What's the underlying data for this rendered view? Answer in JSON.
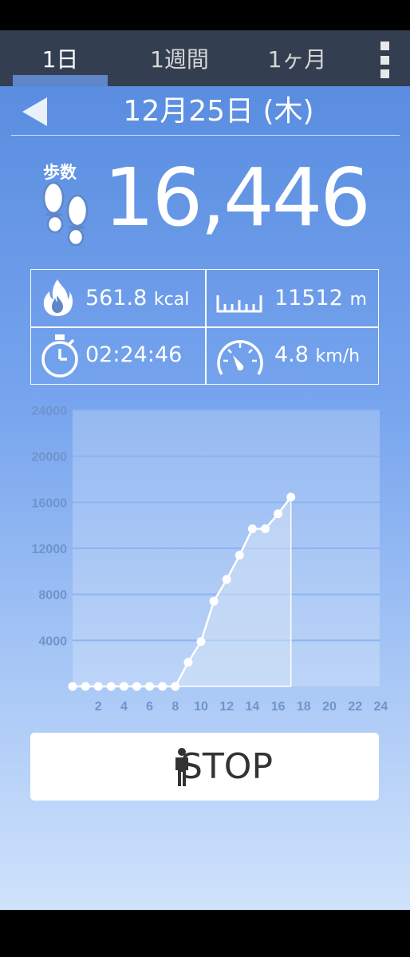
{
  "tabs": [
    {
      "label": "1日"
    },
    {
      "label": "1週間"
    },
    {
      "label": "1ヶ月"
    }
  ],
  "date": "12月25日 (木)",
  "steps": {
    "label": "歩数",
    "value": "16,446"
  },
  "stats": {
    "calories": {
      "value": "561.8",
      "unit": "kcal"
    },
    "distance": {
      "value": "11512",
      "unit": "m"
    },
    "time": {
      "value": "02:24:46"
    },
    "speed": {
      "value": "4.8",
      "unit": "km/h"
    }
  },
  "colors": {
    "header": "#333f50",
    "accent": "#5e86c8",
    "fire_icon": "#ffffff"
  },
  "chart_data": {
    "type": "area",
    "x": [
      0,
      1,
      2,
      3,
      4,
      5,
      6,
      7,
      8,
      9,
      10,
      11,
      12,
      13,
      14,
      15,
      16,
      17
    ],
    "values": [
      0,
      0,
      0,
      0,
      0,
      0,
      0,
      0,
      0,
      2100,
      3900,
      7400,
      9300,
      11400,
      13700,
      13700,
      15000,
      16446
    ],
    "xticks": [
      "2",
      "4",
      "6",
      "8",
      "10",
      "12",
      "14",
      "16",
      "18",
      "20",
      "22",
      "24"
    ],
    "yticks": [
      "4000",
      "8000",
      "12000",
      "16000",
      "20000",
      "24000"
    ],
    "xlim": [
      0,
      24
    ],
    "ylim": [
      0,
      24000
    ],
    "grid": true
  },
  "stop_button": {
    "label": "STOP"
  }
}
